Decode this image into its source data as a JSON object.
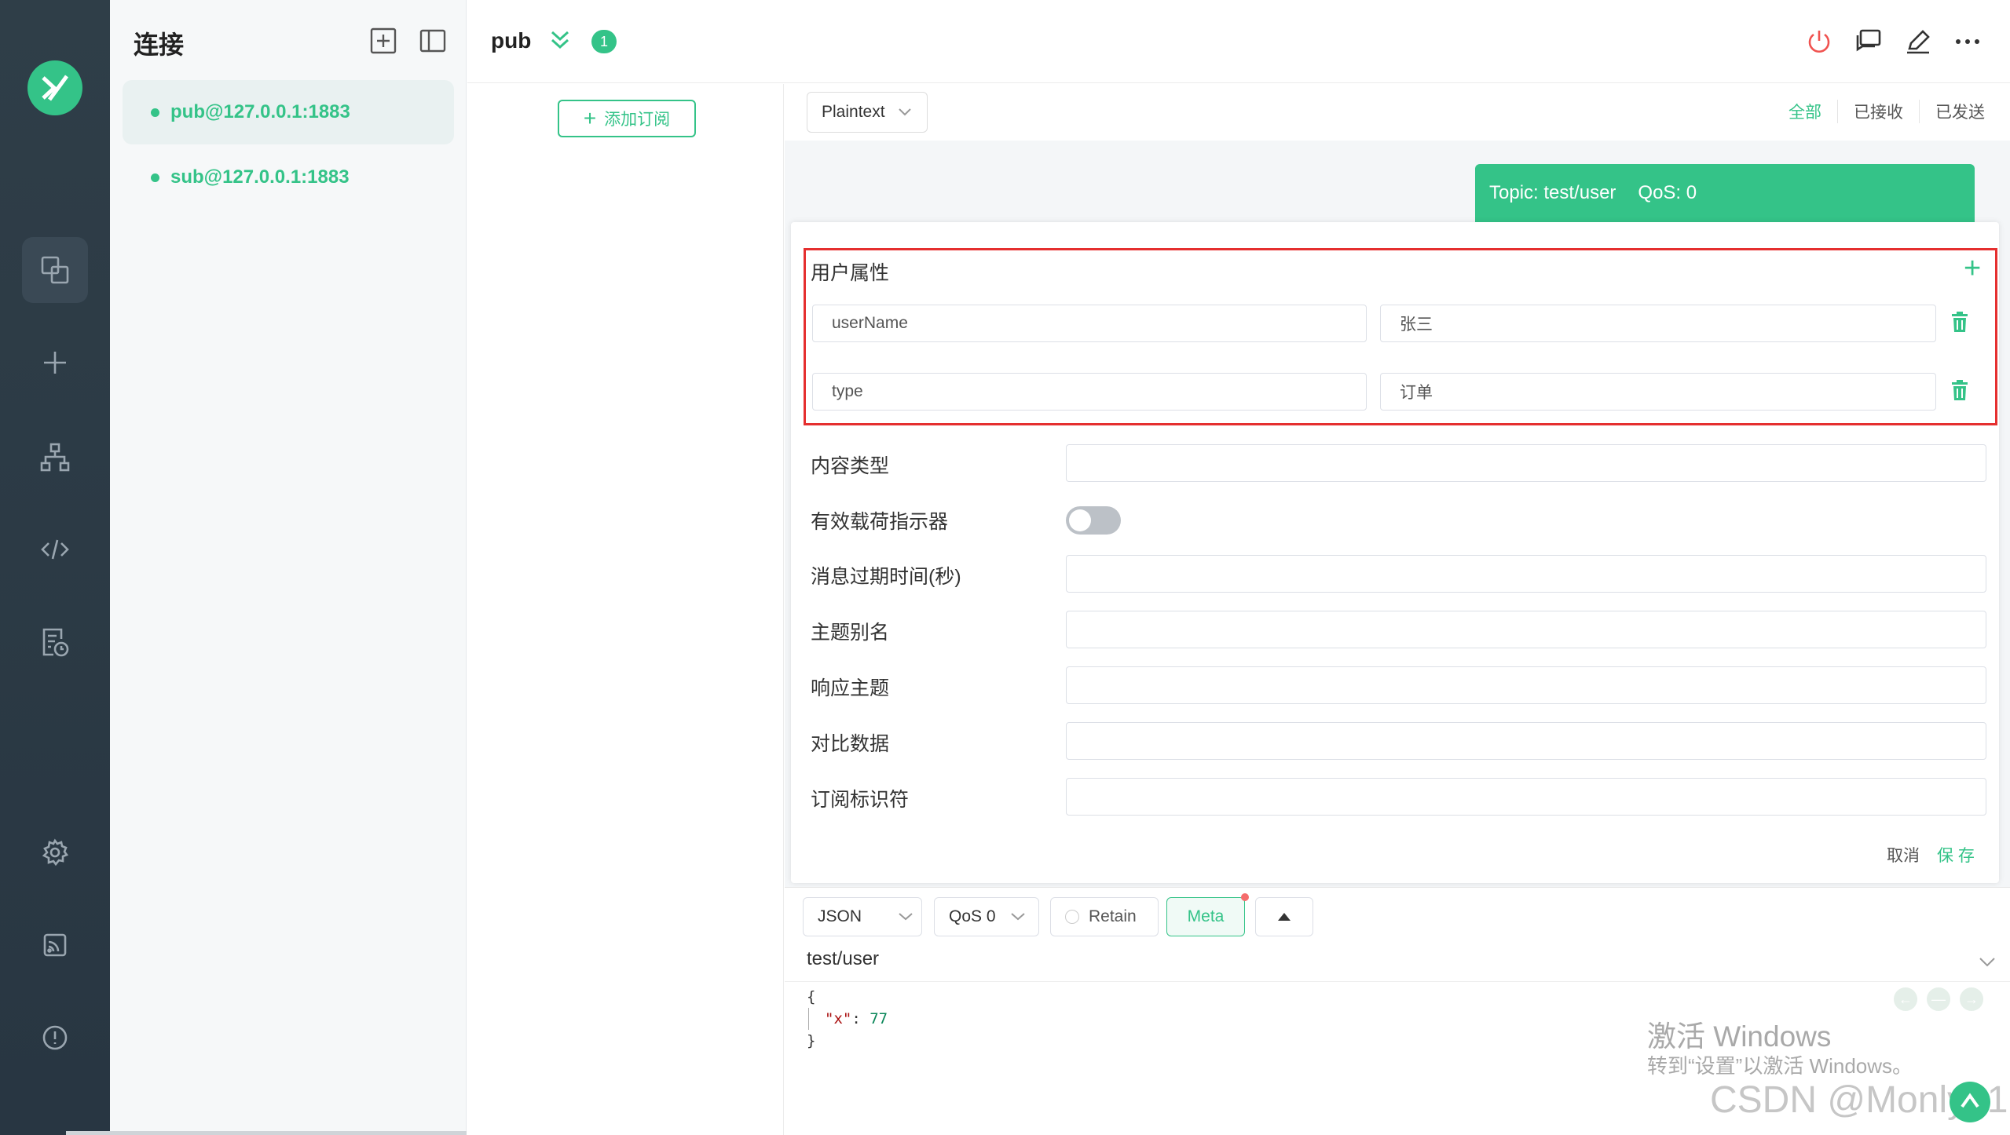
{
  "sidebar": {
    "title": "连接",
    "connections": [
      {
        "label": "pub@127.0.0.1:1883",
        "active": true
      },
      {
        "label": "sub@127.0.0.1:1883",
        "active": false
      }
    ]
  },
  "header": {
    "title": "pub",
    "badge": "1"
  },
  "subscriptions": {
    "add_label": "添加订阅"
  },
  "toolbar": {
    "format": "Plaintext",
    "filters": [
      "全部",
      "已接收",
      "已发送"
    ]
  },
  "message": {
    "topic_label": "Topic: test/user",
    "qos_label": "QoS: 0"
  },
  "meta_panel": {
    "user_props_title": "用户属性",
    "user_props": [
      {
        "key": "userName",
        "value": "张三"
      },
      {
        "key": "type",
        "value": "订单"
      }
    ],
    "fields": [
      {
        "label": "内容类型"
      },
      {
        "label": "有效载荷指示器"
      },
      {
        "label": "消息过期时间(秒)"
      },
      {
        "label": "主题别名"
      },
      {
        "label": "响应主题"
      },
      {
        "label": "对比数据"
      },
      {
        "label": "订阅标识符"
      }
    ],
    "cancel": "取消",
    "save": "保 存"
  },
  "composer": {
    "payload_format": "JSON",
    "qos": "QoS 0",
    "retain": "Retain",
    "meta": "Meta",
    "topic": "test/user",
    "code_open": "{",
    "code_key": "\"x\"",
    "code_colon": ": ",
    "code_value": "77",
    "code_close": "}"
  },
  "watermark": {
    "line1": "激活 Windows",
    "line2": "转到“设置”以激活 Windows。",
    "csdn": "CSDN @Monly21"
  },
  "colors": {
    "accent": "#34c388",
    "rail": "#2f3e48",
    "highlight_box": "#e52f2f"
  }
}
